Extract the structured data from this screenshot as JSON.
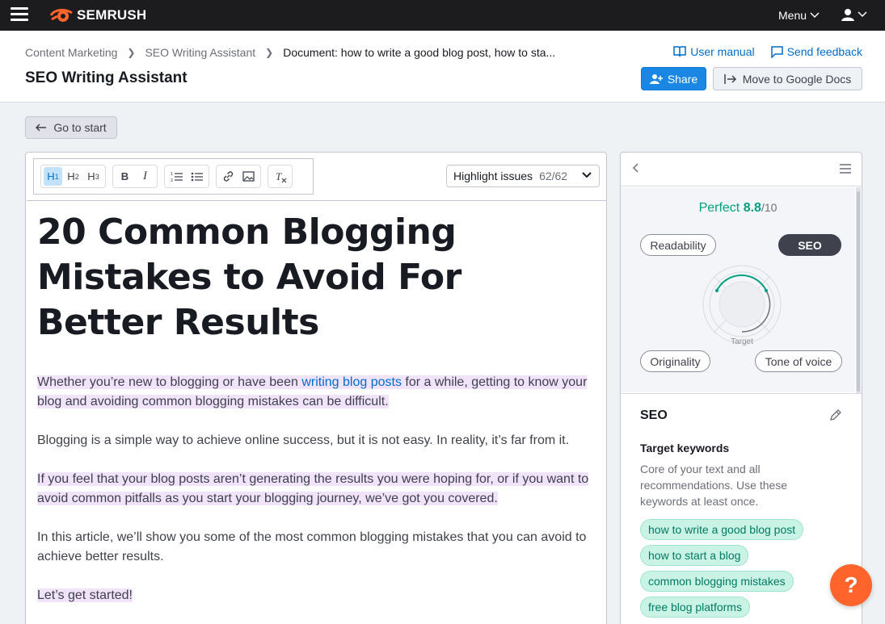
{
  "topbar": {
    "brand": "SEMRUSH",
    "menu_label": "Menu"
  },
  "header": {
    "breadcrumb": [
      "Content Marketing",
      "SEO Writing Assistant",
      "Document: how to write a good blog post, how to sta..."
    ],
    "title": "SEO Writing Assistant",
    "user_manual": "User manual",
    "send_feedback": "Send feedback",
    "share": "Share",
    "move_to_docs": "Move to Google Docs"
  },
  "go_to_start": "Go to start",
  "toolbar": {
    "h1": "H",
    "h1_sub": "1",
    "h2": "H",
    "h2_sub": "2",
    "h3": "H",
    "h3_sub": "3",
    "bold": "B",
    "italic": "I",
    "highlight_label": "Highlight issues",
    "highlight_count": "62/62"
  },
  "document": {
    "heading": "20 Common Blogging Mistakes to Avoid For Better Results",
    "p1_before": "Whether you’re new to blogging or have been ",
    "p1_link": "writing blog posts",
    "p1_after": " for a while, getting to know your blog and avoiding common blogging mistakes can be difficult.",
    "p2": "Blogging is a simple way to achieve online success, but it is not easy. In reality, it’s far from it.",
    "p3": "If you feel that your blog posts aren’t generating the results you were hoping for, or if you want to avoid common pitfalls as you start your blogging journey, we’ve got you covered.",
    "p4": "In this article, we’ll show you some of the most common blogging mistakes that you can avoid to achieve better results.",
    "p5": "Let’s get started!"
  },
  "panel": {
    "score_label": "Perfect",
    "score_value": "8.8",
    "score_max": "/10",
    "pills": {
      "readability": "Readability",
      "seo": "SEO",
      "originality": "Originality",
      "tone": "Tone of voice"
    },
    "target_label": "Target",
    "seo_title": "SEO",
    "kw_title": "Target keywords",
    "kw_desc": "Core of your text and all recommendations. Use these keywords at least once.",
    "keywords": [
      "how to write a good blog post",
      "how to start a blog",
      "common blogging mistakes",
      "free blog platforms"
    ]
  },
  "help_label": "?",
  "colors": {
    "accent": "#1a87e5",
    "brand": "#ff642d",
    "success": "#009f81",
    "highlight": "#f0e3fa"
  }
}
